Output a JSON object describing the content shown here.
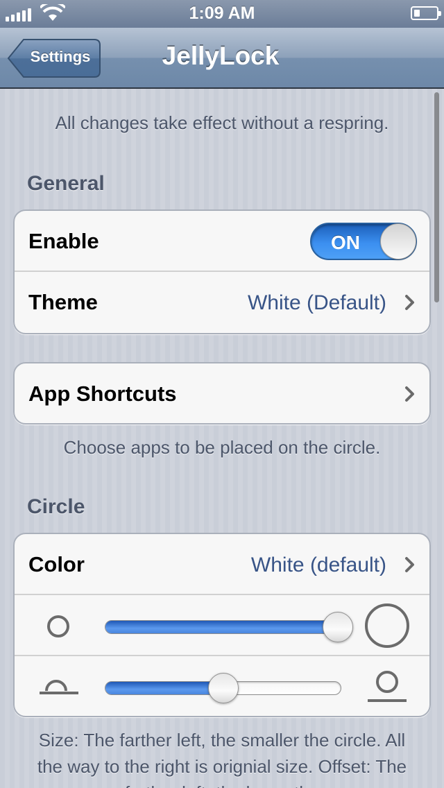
{
  "status_bar": {
    "time": "1:09 AM",
    "signal_bars": 5
  },
  "nav": {
    "back_label": "Settings",
    "title": "JellyLock"
  },
  "intro": "All changes take effect without a respring.",
  "general": {
    "header": "General",
    "enable_label": "Enable",
    "enable_state": "ON",
    "theme_label": "Theme",
    "theme_value": "White (Default)"
  },
  "shortcuts": {
    "label": "App Shortcuts",
    "footer": "Choose apps to be placed on the circle."
  },
  "circle": {
    "header": "Circle",
    "color_label": "Color",
    "color_value": "White (default)",
    "size_slider_value": 1.0,
    "offset_slider_value": 0.5,
    "footer": "Size: The farther left, the smaller the circle. All the way to the right is orignial size. Offset: The farther left, the lower the"
  },
  "colors": {
    "accent_blue": "#3b8ff0",
    "value_text": "#385487",
    "group_header": "#4c566a"
  },
  "icons": {
    "back": "back-arrow-icon",
    "chevron": "chevron-right-icon",
    "small_circle": "small-circle-icon",
    "large_circle": "large-circle-icon",
    "offset_low": "circle-offset-low-icon",
    "offset_high": "circle-offset-high-icon"
  }
}
